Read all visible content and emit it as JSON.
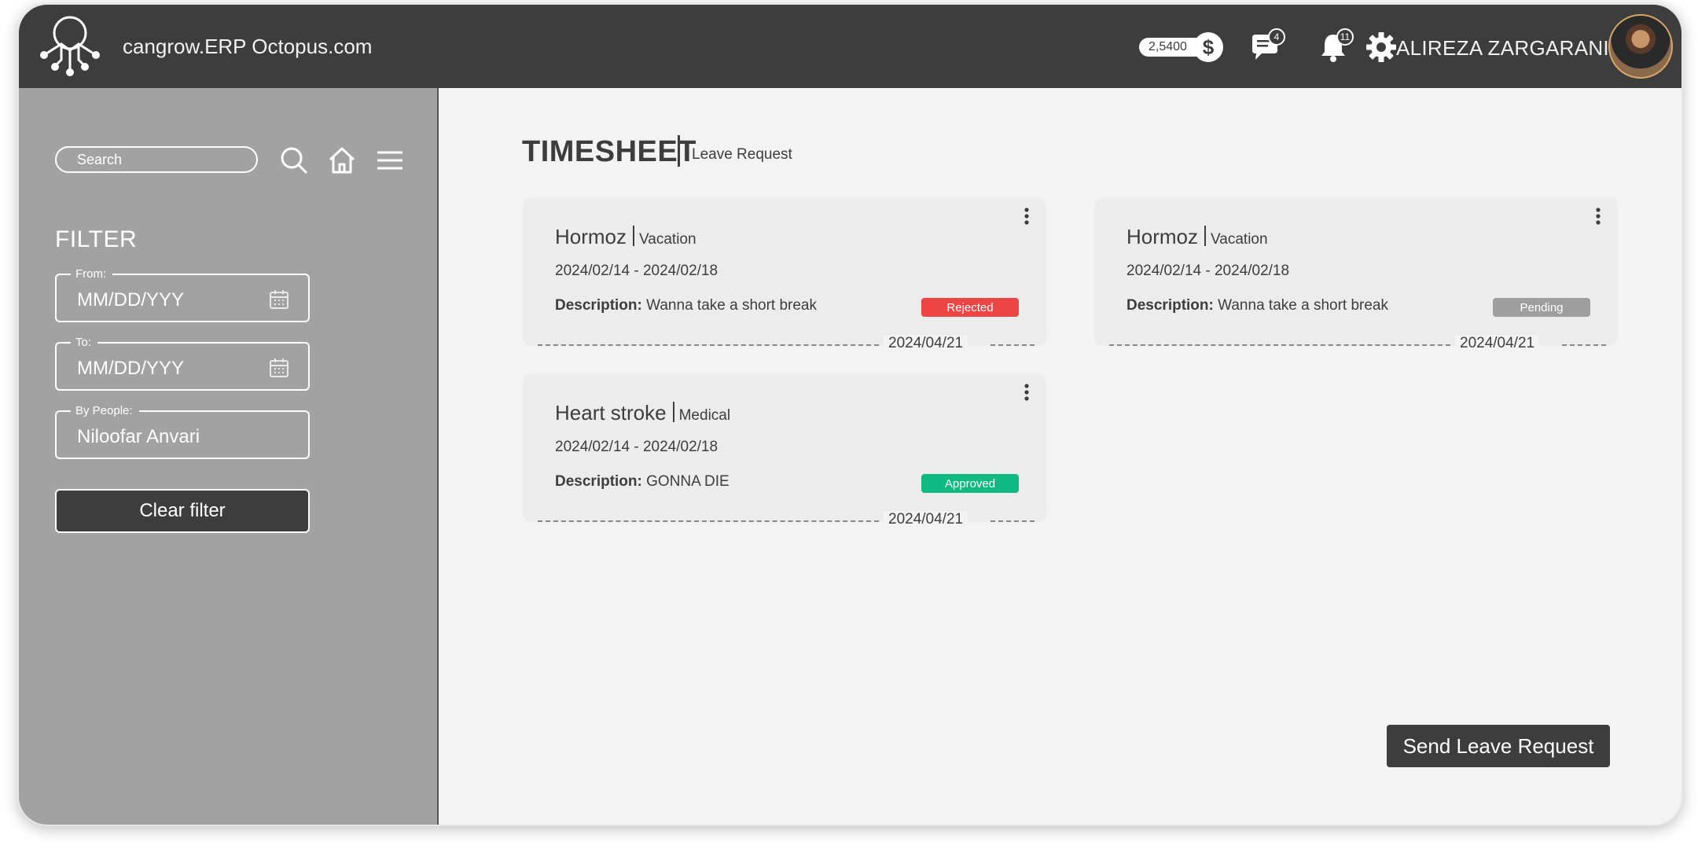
{
  "header": {
    "app_title": "cangrow.ERP Octopus.com",
    "credit_amount": "2,5400",
    "credit_icon": "$",
    "messages_count": "4",
    "notifications_count": "11",
    "user_name": "ALIREZA ZARGARANI"
  },
  "sidebar": {
    "search_placeholder": "Search",
    "filter_title": "FILTER",
    "from": {
      "label": "From:",
      "value": "MM/DD/YYY"
    },
    "to": {
      "label": "To:",
      "value": "MM/DD/YYY"
    },
    "by_people": {
      "label": "By People:",
      "value": "Niloofar Anvari"
    },
    "clear_button": "Clear filter"
  },
  "main": {
    "title": "TIMESHEET",
    "subtitle": "Leave Request",
    "description_label": "Description:",
    "cards": [
      {
        "name": "Hormoz",
        "type": "Vacation",
        "dates": "2024/02/14 - 2024/02/18",
        "description": "Wanna take a short break",
        "status": "Rejected",
        "status_color": "#ef4444",
        "footer_date": "2024/04/21"
      },
      {
        "name": "Hormoz",
        "type": "Vacation",
        "dates": "2024/02/14 - 2024/02/18",
        "description": "Wanna take a short break",
        "status": "Pending",
        "status_color": "#9e9e9e",
        "footer_date": "2024/04/21"
      },
      {
        "name": "Heart stroke",
        "type": "Medical",
        "dates": "2024/02/14 - 2024/02/18",
        "description": "GONNA DIE",
        "status": "Approved",
        "status_color": "#10b981",
        "footer_date": "2024/04/21"
      }
    ],
    "send_button": "Send Leave Request"
  },
  "colors": {
    "topbar": "#3d3d3d",
    "sidebar": "#a2a2a2",
    "main_bg": "#f3f3f3",
    "rejected": "#ef4444",
    "pending": "#9e9e9e",
    "approved": "#10b981"
  }
}
